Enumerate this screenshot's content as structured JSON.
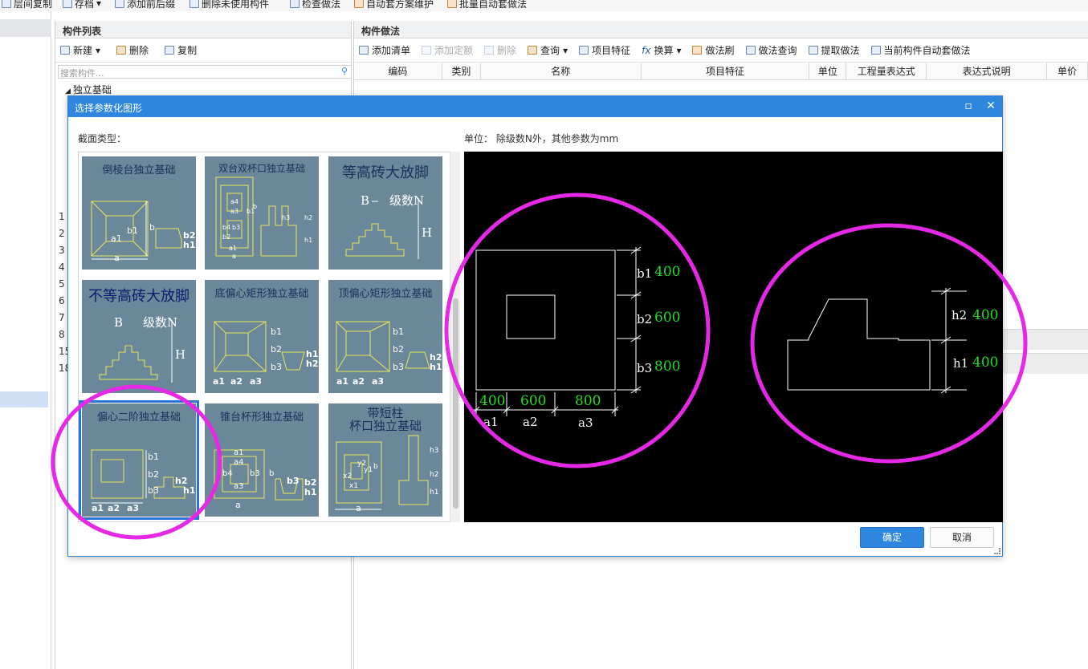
{
  "toolbar": {
    "items": [
      "层间复制",
      "存档",
      "添加前后缀",
      "删除未使用构件",
      "检查做法",
      "自动套方案维护",
      "批量自动套做法"
    ]
  },
  "component_panel": {
    "title": "构件列表",
    "new_label": "新建",
    "delete_label": "删除",
    "copy_label": "复制",
    "search_placeholder": "搜索构件...",
    "tree_root": "独立基础",
    "row_numbers": [
      "1",
      "2",
      "3",
      "4",
      "5",
      "6",
      "7",
      "8",
      "15",
      "18"
    ]
  },
  "method_panel": {
    "title": "构件做法",
    "actions": [
      "添加清单",
      "添加定额",
      "删除",
      "查询",
      "项目特征",
      "换算",
      "做法刷",
      "做法查询",
      "提取做法",
      "当前构件自动套做法"
    ],
    "columns": [
      "编码",
      "类别",
      "名称",
      "项目特征",
      "单位",
      "工程量表达式",
      "表达式说明",
      "单价"
    ]
  },
  "dialog": {
    "title": "选择参数化图形",
    "section_label": "截面类型：",
    "unit_label": "单位：  除级数N外，其他参数为mm",
    "shapes": [
      {
        "name": "倒棱台独立基础",
        "labels": [
          "b1",
          "b",
          "b2",
          "h1",
          "a1",
          "a"
        ]
      },
      {
        "name": "双台双杯口独立基础",
        "labels": [
          "a4",
          "a3",
          "b4",
          "b3",
          "b2",
          "b1",
          "b",
          "h3",
          "h2",
          "h1",
          "a1",
          "a"
        ]
      },
      {
        "name": "等高砖大放脚",
        "labels": [
          "B",
          "级数N",
          "H"
        ]
      },
      {
        "name": "不等高砖大放脚",
        "labels": [
          "B",
          "级数N",
          "H"
        ]
      },
      {
        "name": "底偏心矩形独立基础",
        "labels": [
          "b1",
          "b2",
          "b3",
          "h1",
          "h2",
          "a1",
          "a2",
          "a3"
        ]
      },
      {
        "name": "顶偏心矩形独立基础",
        "labels": [
          "b1",
          "b2",
          "b3",
          "h2",
          "h1",
          "a1",
          "a2",
          "a3"
        ]
      },
      {
        "name": "偏心二阶独立基础",
        "labels": [
          "b1",
          "b2",
          "b3",
          "h2",
          "h1",
          "a1",
          "a2",
          "a3"
        ]
      },
      {
        "name": "锥台杯形独立基础",
        "labels": [
          "a1",
          "a4",
          "b4",
          "a3",
          "b3",
          "b",
          "b3",
          "b2",
          "h1",
          "a"
        ]
      },
      {
        "name": "带短柱\n杯口独立基础",
        "labels": [
          "h3",
          "h2",
          "h1",
          "x2",
          "x1",
          "y1",
          "y2",
          "b",
          "a"
        ]
      }
    ],
    "selected_index": 6,
    "preview": {
      "params": {
        "b1": "400",
        "b2": "600",
        "b3": "800",
        "a1": "400",
        "a2": "600",
        "a3": "800",
        "h2": "400",
        "h1": "400"
      },
      "names": {
        "b1": "b1",
        "b2": "b2",
        "b3": "b3",
        "a1": "a1",
        "a2": "a2",
        "a3": "a3",
        "h2": "h2",
        "h1": "h1"
      }
    },
    "ok_label": "确定",
    "cancel_label": "取消"
  },
  "colors": {
    "accent": "#2e86de",
    "thumb_bg": "#6a8899",
    "line_yellow": "#e8e85a",
    "value_green": "#22dd22",
    "annotation_magenta": "#e528e5"
  }
}
